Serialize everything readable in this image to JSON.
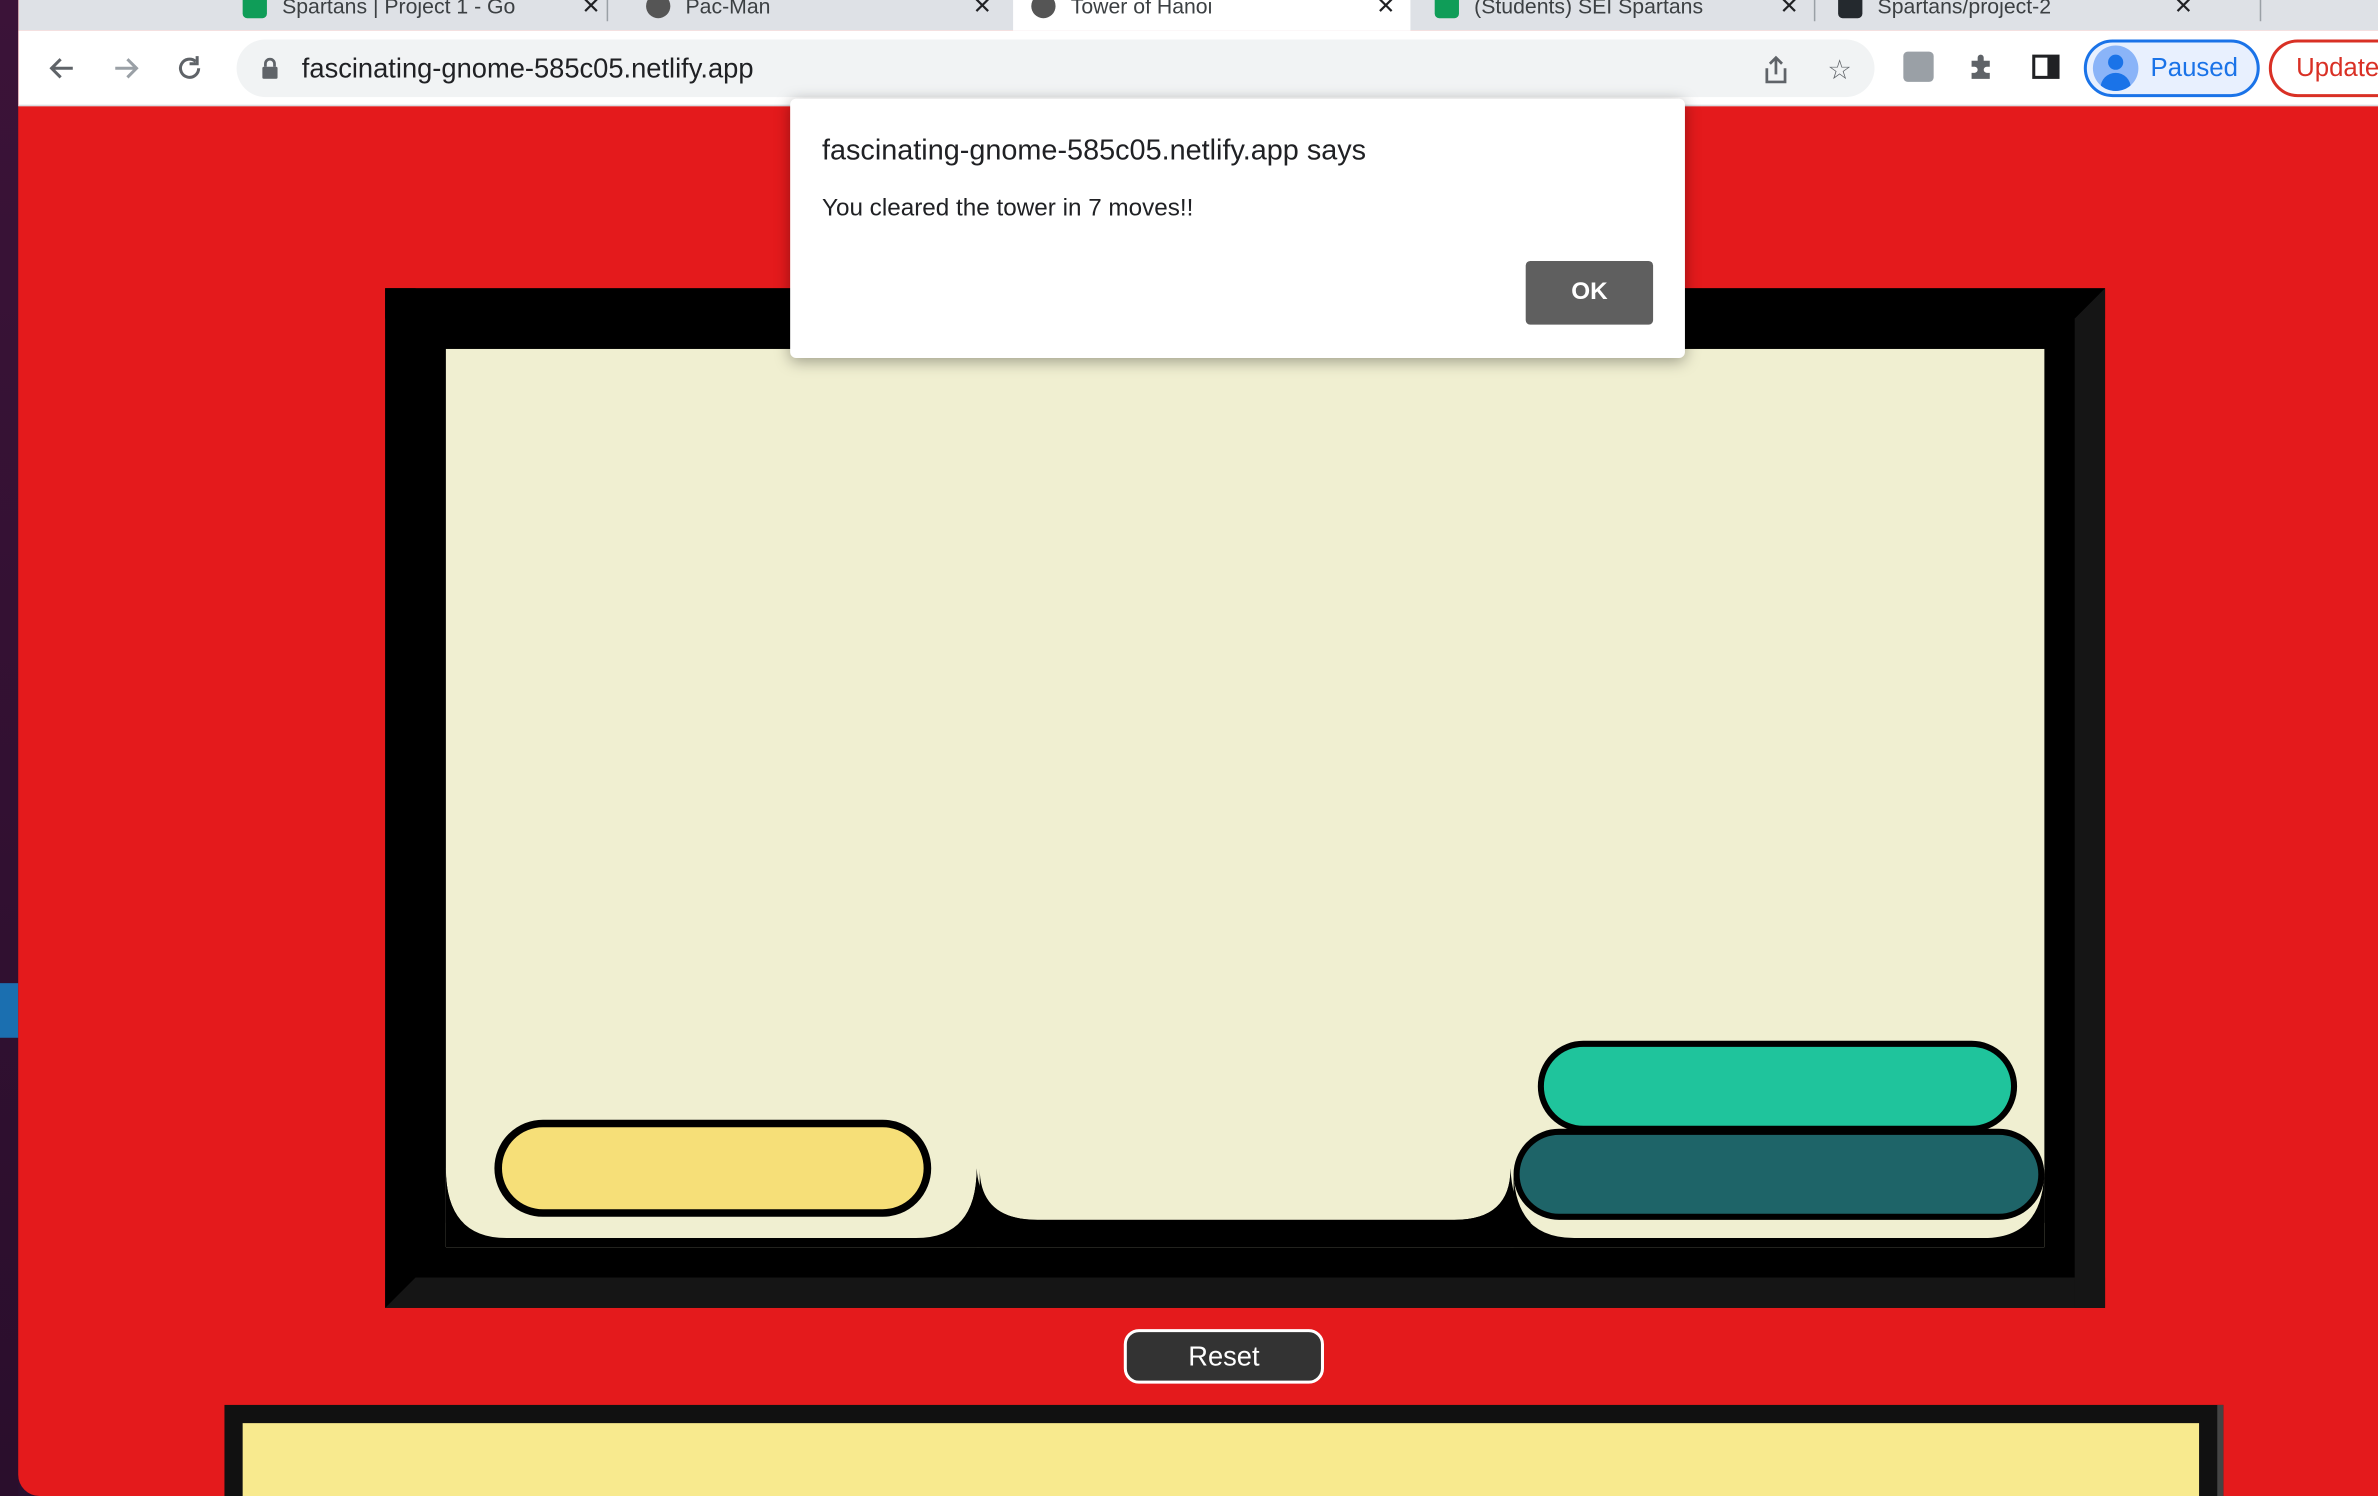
{
  "browser": {
    "tabs": [
      {
        "title": "Spartans | Project 1 - Go",
        "favicon": "sheets-icon"
      },
      {
        "title": "Pac-Man",
        "favicon": "globe-icon"
      },
      {
        "title": "Tower of Hanoi",
        "favicon": "globe-icon",
        "active": true
      },
      {
        "title": "(Students) SEI Spartans",
        "favicon": "sheets-icon"
      },
      {
        "title": "Spartans/project-2",
        "favicon": "github-icon"
      }
    ],
    "url": "fascinating-gnome-585c05.netlify.app",
    "profile_label": "Paused",
    "update_label": "Update"
  },
  "dialog": {
    "title": "fascinating-gnome-585c05.netlify.app says",
    "message": "You cleared the tower in 7 moves!!",
    "ok_label": "OK"
  },
  "game": {
    "reset_label": "Reset",
    "pegs": [
      {
        "disks": [
          {
            "color": "#f6df78"
          }
        ]
      },
      {
        "disks": []
      },
      {
        "disks": [
          {
            "color": "#1e6468"
          },
          {
            "color": "#1fc49c"
          }
        ]
      }
    ],
    "colors": {
      "background": "#e41a1c",
      "board": "#f0efd1",
      "frame": "#000000",
      "bottom_panel": "#f8ea8e"
    }
  }
}
